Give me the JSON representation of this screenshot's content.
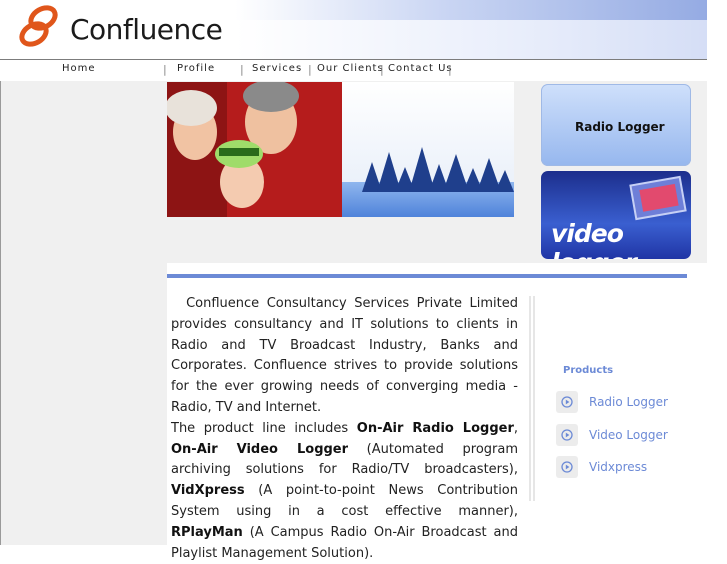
{
  "brand": {
    "name": "Confluence"
  },
  "nav": {
    "items": [
      "Home",
      "Profile",
      "Services",
      "Our Clients",
      "Contact Us"
    ]
  },
  "tiles": {
    "radio_label": "Radio Logger",
    "video_label": "video logger"
  },
  "intro": {
    "p1": "Confluence Consultancy Services Private Limited provides consultancy and IT solutions to clients in Radio and TV Broadcast Industry, Banks and Corporates. Confluence strives to provide solutions for the ever growing needs of converging media - Radio, TV and Internet.",
    "p2_lead": "The product line includes ",
    "p2_prod1": "On-Air Radio Logger",
    "p2_sep1": ", ",
    "p2_prod2": "On-Air Video Logger",
    "p2_desc2": " (Automated program archiving solutions for Radio/TV broadcasters), ",
    "p2_prod3": "VidXpress",
    "p2_desc3": " (A point-to-point News Contribution System using in a cost effective manner), ",
    "p2_prod4": "RPlayMan",
    "p2_desc4": " (A Campus Radio On-Air Broadcast and Playlist Management Solution)."
  },
  "products": {
    "heading": "Products",
    "items": [
      "Radio Logger",
      "Video Logger",
      "Vidxpress"
    ]
  },
  "colors": {
    "accent": "#6c8ad6",
    "nav_border": "#7c7c7c",
    "logo": "#e0561b"
  }
}
